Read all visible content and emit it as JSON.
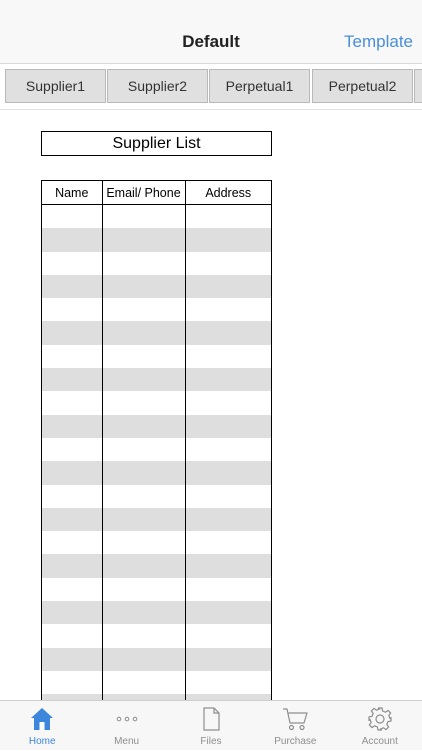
{
  "navbar": {
    "title": "Default",
    "right_action": "Template"
  },
  "tabs": [
    {
      "label": "Supplier1"
    },
    {
      "label": "Supplier2"
    },
    {
      "label": "Perpetual1"
    },
    {
      "label": "Perpetual2"
    }
  ],
  "sheet": {
    "title": "Supplier List",
    "columns": [
      "Name",
      "Email/ Phone",
      "Address"
    ]
  },
  "tabbar": {
    "items": [
      {
        "label": "Home",
        "icon": "home-icon",
        "active": true
      },
      {
        "label": "Menu",
        "icon": "more-icon",
        "active": false
      },
      {
        "label": "Files",
        "icon": "file-icon",
        "active": false
      },
      {
        "label": "Purchase",
        "icon": "cart-icon",
        "active": false
      },
      {
        "label": "Account",
        "icon": "gear-icon",
        "active": false
      }
    ]
  },
  "colors": {
    "accent": "#3c86dc",
    "nav_link": "#4a8ed8",
    "row_shade": "#dedede",
    "tab_bg": "#e0e0e0"
  }
}
